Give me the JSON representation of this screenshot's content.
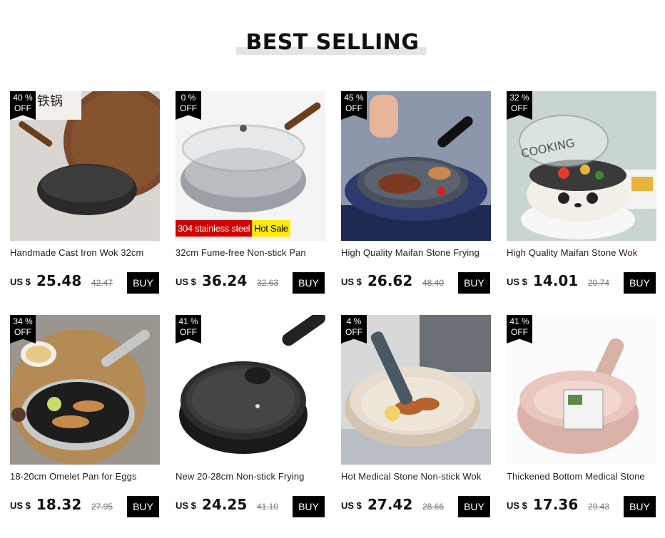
{
  "header": {
    "title": "BEST SELLING"
  },
  "products": [
    {
      "discount_pct": "40 %",
      "discount_off": "OFF",
      "title": "Handmade Cast Iron Wok 32cm",
      "currency": "US $",
      "price": "25.48",
      "old_price": "42.47",
      "buy_label": "BUY",
      "image_icon": "cast-iron-wok-image",
      "colors": {
        "bg": "#d9d6d2",
        "pan": "#2a2a2a",
        "accent": "#7a4a2a"
      }
    },
    {
      "discount_pct": "0 %",
      "discount_off": "OFF",
      "title": "32cm Fume-free Non-stick Pan",
      "currency": "US $",
      "price": "36.24",
      "old_price": "32.63",
      "buy_label": "BUY",
      "image_icon": "stainless-wok-image",
      "tag_red": "304 stainless steel",
      "tag_yellow": "Hot Sale",
      "colors": {
        "bg": "#f4f4f4",
        "pan": "#b9bdc2",
        "accent": "#6b3e1e"
      }
    },
    {
      "discount_pct": "45 %",
      "discount_off": "OFF",
      "title": "High Quality Maifan Stone Frying",
      "currency": "US $",
      "price": "26.62",
      "old_price": "48.40",
      "buy_label": "BUY",
      "image_icon": "frying-pan-steak-image",
      "colors": {
        "bg": "#8c97ab",
        "pan": "#4a4f5c",
        "accent": "#7a3b22"
      }
    },
    {
      "discount_pct": "32 %",
      "discount_off": "OFF",
      "title": "High Quality Maifan Stone Wok",
      "currency": "US $",
      "price": "14.01",
      "old_price": "20.74",
      "buy_label": "BUY",
      "image_icon": "panda-wok-image",
      "colors": {
        "bg": "#c9d6cf",
        "pan": "#f2efe8",
        "accent": "#e7b53a"
      }
    },
    {
      "discount_pct": "34 %",
      "discount_off": "OFF",
      "title": "18-20cm Omelet Pan for Eggs",
      "currency": "US $",
      "price": "18.32",
      "old_price": "27.95",
      "buy_label": "BUY",
      "image_icon": "omelet-pan-image",
      "colors": {
        "bg": "#9a958f",
        "pan": "#1d1d1d",
        "accent": "#c79a5a"
      }
    },
    {
      "discount_pct": "41 %",
      "discount_off": "OFF",
      "title": "New 20-28cm Non-stick Frying",
      "currency": "US $",
      "price": "24.25",
      "old_price": "41.10",
      "buy_label": "BUY",
      "image_icon": "black-frying-pan-image",
      "colors": {
        "bg": "#ffffff",
        "pan": "#222222",
        "accent": "#5a5a5a"
      }
    },
    {
      "discount_pct": "4 %",
      "discount_off": "OFF",
      "title": "Hot Medical Stone Non-stick Wok",
      "currency": "US $",
      "price": "27.42",
      "old_price": "28.66",
      "buy_label": "BUY",
      "image_icon": "cream-wok-image",
      "colors": {
        "bg": "#d8d8d8",
        "pan": "#e7dccd",
        "accent": "#4a5866"
      }
    },
    {
      "discount_pct": "41 %",
      "discount_off": "OFF",
      "title": "Thickened Bottom Medical Stone",
      "currency": "US $",
      "price": "17.36",
      "old_price": "29.43",
      "buy_label": "BUY",
      "image_icon": "pink-milk-pan-image",
      "colors": {
        "bg": "#fbfbfb",
        "pan": "#e9c7be",
        "accent": "#d9b2a7"
      }
    }
  ]
}
